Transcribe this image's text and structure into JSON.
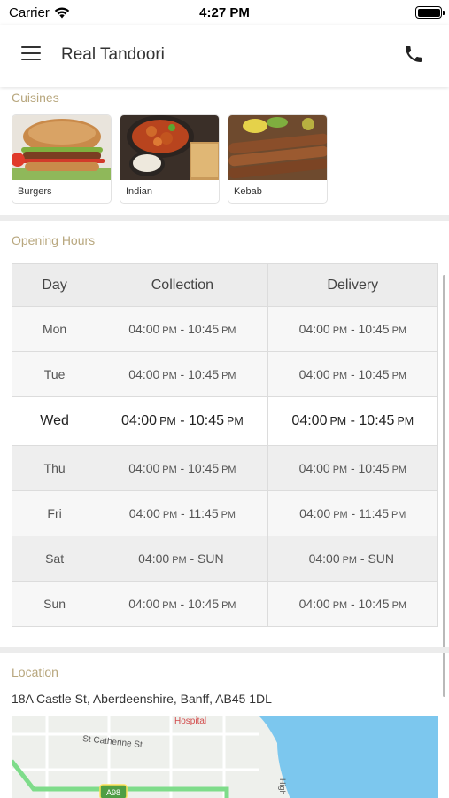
{
  "status_bar": {
    "carrier": "Carrier",
    "time": "4:27 PM"
  },
  "header": {
    "title": "Real Tandoori"
  },
  "cuisines": {
    "label": "Cuisines",
    "items": [
      {
        "name": "Burgers"
      },
      {
        "name": "Indian"
      },
      {
        "name": "Kebab"
      }
    ]
  },
  "opening_hours": {
    "label": "Opening Hours",
    "columns": [
      "Day",
      "Collection",
      "Delivery"
    ],
    "rows": [
      {
        "day": "Mon",
        "collection": {
          "from": "04:00",
          "from_ampm": "PM",
          "to": "10:45",
          "to_ampm": "PM"
        },
        "delivery": {
          "from": "04:00",
          "from_ampm": "PM",
          "to": "10:45",
          "to_ampm": "PM"
        }
      },
      {
        "day": "Tue",
        "collection": {
          "from": "04:00",
          "from_ampm": "PM",
          "to": "10:45",
          "to_ampm": "PM"
        },
        "delivery": {
          "from": "04:00",
          "from_ampm": "PM",
          "to": "10:45",
          "to_ampm": "PM"
        }
      },
      {
        "day": "Wed",
        "collection": {
          "from": "04:00",
          "from_ampm": "PM",
          "to": "10:45",
          "to_ampm": "PM"
        },
        "delivery": {
          "from": "04:00",
          "from_ampm": "PM",
          "to": "10:45",
          "to_ampm": "PM"
        }
      },
      {
        "day": "Thu",
        "collection": {
          "from": "04:00",
          "from_ampm": "PM",
          "to": "10:45",
          "to_ampm": "PM"
        },
        "delivery": {
          "from": "04:00",
          "from_ampm": "PM",
          "to": "10:45",
          "to_ampm": "PM"
        }
      },
      {
        "day": "Fri",
        "collection": {
          "from": "04:00",
          "from_ampm": "PM",
          "to": "11:45",
          "to_ampm": "PM"
        },
        "delivery": {
          "from": "04:00",
          "from_ampm": "PM",
          "to": "11:45",
          "to_ampm": "PM"
        }
      },
      {
        "day": "Sat",
        "collection": {
          "from": "04:00",
          "from_ampm": "PM",
          "to": "SUN",
          "to_ampm": ""
        },
        "delivery": {
          "from": "04:00",
          "from_ampm": "PM",
          "to": "SUN",
          "to_ampm": ""
        }
      },
      {
        "day": "Sun",
        "collection": {
          "from": "04:00",
          "from_ampm": "PM",
          "to": "10:45",
          "to_ampm": "PM"
        },
        "delivery": {
          "from": "04:00",
          "from_ampm": "PM",
          "to": "10:45",
          "to_ampm": "PM"
        }
      }
    ]
  },
  "location": {
    "label": "Location",
    "address": "18A Castle St, Aberdeenshire, Banff, AB45 1DL",
    "map": {
      "poi": "Hospital",
      "street": "St Catherine St",
      "road_badge": "A98",
      "side_street": "High"
    }
  },
  "colors": {
    "section_label": "#b8a77e",
    "divider": "#ececec",
    "sea": "#7cc7ee",
    "route": "#7edc8a"
  }
}
